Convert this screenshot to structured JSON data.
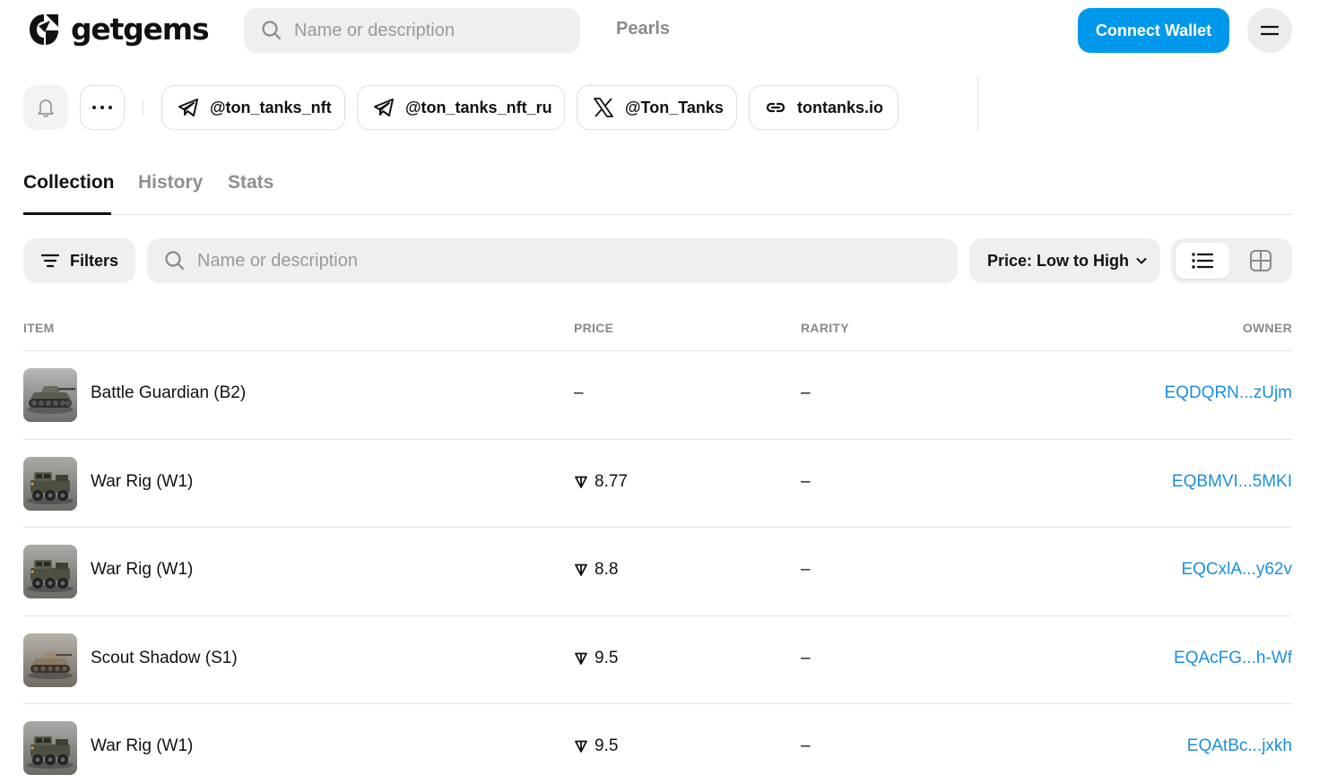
{
  "header": {
    "logo_text": "getgems",
    "search_placeholder": "Name or description",
    "pearls_label": "Pearls",
    "connect_wallet_label": "Connect Wallet"
  },
  "social": {
    "links": [
      {
        "label": "@ton_tanks_nft",
        "icon": "telegram-icon"
      },
      {
        "label": "@ton_tanks_nft_ru",
        "icon": "telegram-icon"
      },
      {
        "label": "@Ton_Tanks",
        "icon": "x-icon"
      },
      {
        "label": "tontanks.io",
        "icon": "link-icon"
      }
    ]
  },
  "tabs": [
    {
      "label": "Collection",
      "active": true
    },
    {
      "label": "History",
      "active": false
    },
    {
      "label": "Stats",
      "active": false
    }
  ],
  "toolbar": {
    "filters_label": "Filters",
    "search_placeholder": "Name or description",
    "sort_label": "Price: Low to High"
  },
  "table": {
    "columns": [
      "ITEM",
      "PRICE",
      "RARITY",
      "OWNER"
    ],
    "rows": [
      {
        "name": "Battle Guardian (B2)",
        "price": "–",
        "has_ton_icon": false,
        "rarity": "–",
        "owner": "EQDQRN...zUjm",
        "thumb": "tank"
      },
      {
        "name": "War Rig (W1)",
        "price": "8.77",
        "has_ton_icon": true,
        "rarity": "–",
        "owner": "EQBMVI...5MKI",
        "thumb": "truck"
      },
      {
        "name": "War Rig (W1)",
        "price": "8.8",
        "has_ton_icon": true,
        "rarity": "–",
        "owner": "EQCxlA...y62v",
        "thumb": "truck"
      },
      {
        "name": "Scout Shadow (S1)",
        "price": "9.5",
        "has_ton_icon": true,
        "rarity": "–",
        "owner": "EQAcFG...h-Wf",
        "thumb": "tank-light"
      },
      {
        "name": "War Rig (W1)",
        "price": "9.5",
        "has_ton_icon": true,
        "rarity": "–",
        "owner": "EQAtBc...jxkh",
        "thumb": "truck"
      }
    ]
  },
  "colors": {
    "accent": "#0098ea",
    "owner_link": "#1a8fe0",
    "muted": "#8a8a8a"
  }
}
